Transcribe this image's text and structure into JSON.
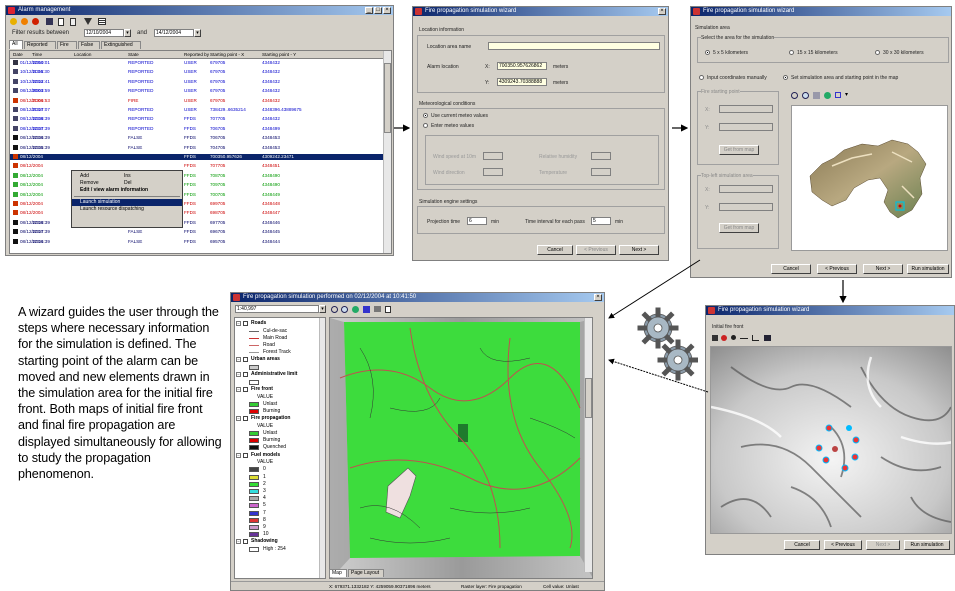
{
  "alarm_window": {
    "title": "Alarm management",
    "filter_label": "Filter results between",
    "date_from": "12/10/2004",
    "and_label": "and",
    "date_to": "14/12/2004",
    "tabs": [
      "All",
      "Reported",
      "Fire",
      "False",
      "Extinguished"
    ],
    "columns": [
      "Date",
      "Time",
      "Location",
      "State",
      "Reported by",
      "Starting point - X",
      "Starting point - Y"
    ],
    "rows": [
      {
        "date": "01/12/2004",
        "time": "12:50:01",
        "location": "",
        "state": "REPORTED",
        "by": "USER",
        "x": "679705",
        "y": "4348432",
        "color": "#0000cc"
      },
      {
        "date": "10/12/2004",
        "time": "11:36:30",
        "location": "",
        "state": "REPORTED",
        "by": "USER",
        "x": "679705",
        "y": "4348432",
        "color": "#0000cc"
      },
      {
        "date": "10/12/2004",
        "time": "12:22:41",
        "location": "",
        "state": "REPORTED",
        "by": "USER",
        "x": "679705",
        "y": "4348432",
        "color": "#0000cc"
      },
      {
        "date": "08/12/2004",
        "time": "20:03:59",
        "location": "",
        "state": "REPORTED",
        "by": "USER",
        "x": "679705",
        "y": "4348432",
        "color": "#0000cc"
      },
      {
        "date": "08/12/2004",
        "time": "21:06:53",
        "location": "",
        "state": "FIRE",
        "by": "USER",
        "x": "679705",
        "y": "4348432",
        "color": "#cc0000"
      },
      {
        "date": "08/12/2004",
        "time": "21:27:07",
        "location": "",
        "state": "REPORTED",
        "by": "USER",
        "x": "738429..6635214",
        "y": "4348396.43889675",
        "color": "#0000cc"
      },
      {
        "date": "08/12/2004",
        "time": "12:38:39",
        "location": "",
        "state": "REPORTED",
        "by": "FFDS",
        "x": "707705",
        "y": "4348432",
        "color": "#0000cc"
      },
      {
        "date": "08/12/2004",
        "time": "12:37:39",
        "location": "",
        "state": "REPORTED",
        "by": "FFDS",
        "x": "706705",
        "y": "4348499",
        "color": "#0000cc"
      },
      {
        "date": "08/12/2004",
        "time": "12:36:39",
        "location": "",
        "state": "FALSE",
        "by": "FFDS",
        "x": "706705",
        "y": "4348453",
        "color": "#000066"
      },
      {
        "date": "08/12/2004",
        "time": "12:35:39",
        "location": "",
        "state": "FALSE",
        "by": "FFDS",
        "x": "704705",
        "y": "4348453",
        "color": "#000066"
      },
      {
        "date": "08/12/2004",
        "time": "",
        "location": "",
        "state": "",
        "by": "FFDS",
        "x": "700350.957626",
        "y": "4309242.23471",
        "color": "#ffffff"
      },
      {
        "date": "08/12/2004",
        "time": "",
        "location": "",
        "state": "",
        "by": "FFDS",
        "x": "707705",
        "y": "4348451",
        "color": "#cc0000"
      },
      {
        "date": "08/12/2004",
        "time": "",
        "location": "",
        "state": "",
        "by": "FFDS",
        "x": "708705",
        "y": "4348490",
        "color": "#009900"
      },
      {
        "date": "08/12/2004",
        "time": "",
        "location": "",
        "state": "",
        "by": "FFDS",
        "x": "709705",
        "y": "4348490",
        "color": "#009900"
      },
      {
        "date": "08/12/2004",
        "time": "",
        "location": "",
        "state": "",
        "by": "FFDS",
        "x": "700705",
        "y": "4348449",
        "color": "#009900"
      },
      {
        "date": "08/12/2004",
        "time": "",
        "location": "",
        "state": "",
        "by": "FFDS",
        "x": "699705",
        "y": "4348448",
        "color": "#cc0000"
      },
      {
        "date": "08/12/2004",
        "time": "",
        "location": "",
        "state": "",
        "by": "FFDS",
        "x": "698705",
        "y": "4348447",
        "color": "#cc0000"
      },
      {
        "date": "08/12/2004",
        "time": "12:28:39",
        "location": "Perdunta",
        "state": "FALSE",
        "by": "FFDS",
        "x": "697705",
        "y": "4348446",
        "color": "#000066"
      },
      {
        "date": "08/12/2004",
        "time": "12:27:39",
        "location": "",
        "state": "FALSE",
        "by": "FFDS",
        "x": "696705",
        "y": "4348445",
        "color": "#000066"
      },
      {
        "date": "08/12/2004",
        "time": "12:26:39",
        "location": "",
        "state": "FALSE",
        "by": "FFDS",
        "x": "695705",
        "y": "4348444",
        "color": "#000066"
      }
    ],
    "context_menu": [
      {
        "label": "Add",
        "shortcut": "Ins"
      },
      {
        "label": "Remove",
        "shortcut": "Del"
      },
      {
        "label": "Edit / view alarm information",
        "shortcut": ""
      },
      {
        "label": "Launch simulation",
        "shortcut": ""
      },
      {
        "label": "Launch resource dispatching",
        "shortcut": ""
      }
    ]
  },
  "wizard1": {
    "title": "Fire propagation simulation wizard",
    "section_location": "Location information",
    "location_area_name": "Location area name",
    "alarm_location": "Alarm location",
    "x_label": "X:",
    "y_label": "Y:",
    "x_value": "700350.957626862",
    "y_value": "4309243.70388888",
    "meters": "meters",
    "section_meteo": "Meteorological conditions",
    "use_current": "Use current meteo values",
    "enter_values": "Enter meteo values",
    "wind_speed": "Wind speed at 10m",
    "wind_direction": "Wind direction",
    "relative_humidity": "Relative humidity",
    "temperature": "Temperature",
    "section_engine": "Simulation engine settings",
    "projection_time": "Projection time",
    "projection_value": "6",
    "interval": "Time interval for each pass",
    "interval_value": "5",
    "min": "min",
    "cancel": "Cancel",
    "previous": "< Previous",
    "next": "Next >"
  },
  "wizard2": {
    "title": "Fire propagation simulation wizard",
    "sim_area": "Simulation area",
    "select_area": "Select the area for the simulation",
    "opt1": "5 x 5 kilometers",
    "opt2": "15 x 15 kilometers",
    "opt3": "30 x 30 kilometers",
    "input_manually": "Input coordinates manually",
    "set_on_map": "Set simulation area and starting point in the map",
    "fire_starting_point": "Fire starting point",
    "top_left": "Top-left simulation area",
    "get_button": "Get from map",
    "x_label": "X:",
    "y_label": "Y:",
    "cancel": "Cancel",
    "previous": "< Previous",
    "next": "Next >",
    "run": "Run simulation"
  },
  "wizard3": {
    "title": "Fire propagation simulation wizard",
    "initial_fire_front": "Initial fire front",
    "cancel": "Cancel",
    "previous": "< Previous",
    "next": "Next >",
    "run": "Run simulation"
  },
  "result_window": {
    "title": "Fire propagation simulation performed on 02/12/2004 at 10:41:50",
    "scale": "1:40,997",
    "legend": [
      {
        "label": "Roads",
        "type": "group"
      },
      {
        "label": "Cul-de-sac",
        "type": "line",
        "color": "#666666"
      },
      {
        "label": "Main Road",
        "type": "line",
        "color": "#cc3333"
      },
      {
        "label": "Road",
        "type": "line",
        "color": "#cc6666"
      },
      {
        "label": "Forest Track",
        "type": "line",
        "color": "#999999"
      },
      {
        "label": "Urban areas",
        "type": "group"
      },
      {
        "label": "",
        "type": "swatch",
        "color": "#cccccc"
      },
      {
        "label": "Administrative limit",
        "type": "group"
      },
      {
        "label": "",
        "type": "swatch",
        "color": "#ffffff"
      },
      {
        "label": "Fire front",
        "type": "group"
      },
      {
        "label": "VALUE",
        "type": "text"
      },
      {
        "label": "Unlast",
        "type": "swatch",
        "color": "#33cc33"
      },
      {
        "label": "Burning",
        "type": "swatch",
        "color": "#dd0000"
      },
      {
        "label": "Fire propagation",
        "type": "group"
      },
      {
        "label": "VALUE",
        "type": "text"
      },
      {
        "label": "Unlast",
        "type": "swatch",
        "color": "#33cc33"
      },
      {
        "label": "Burning",
        "type": "swatch",
        "color": "#dd0000"
      },
      {
        "label": "Quenched",
        "type": "swatch",
        "color": "#111111"
      },
      {
        "label": "Fuel models",
        "type": "group"
      },
      {
        "label": "VALUE",
        "type": "text"
      },
      {
        "label": "0",
        "type": "swatch",
        "color": "#444444"
      },
      {
        "label": "1",
        "type": "swatch",
        "color": "#dddd33"
      },
      {
        "label": "2",
        "type": "swatch",
        "color": "#33dd33"
      },
      {
        "label": "3",
        "type": "swatch",
        "color": "#33dddd"
      },
      {
        "label": "4",
        "type": "swatch",
        "color": "#aaaaaa"
      },
      {
        "label": "5",
        "type": "swatch",
        "color": "#cc66cc"
      },
      {
        "label": "7",
        "type": "swatch",
        "color": "#3333cc"
      },
      {
        "label": "8",
        "type": "swatch",
        "color": "#dd3333"
      },
      {
        "label": "9",
        "type": "swatch",
        "color": "#cc99cc"
      },
      {
        "label": "10",
        "type": "swatch",
        "color": "#663399"
      },
      {
        "label": "Shadowing",
        "type": "group"
      },
      {
        "label": "High : 254",
        "type": "swatch",
        "color": "#ffffff"
      }
    ],
    "tabs": [
      "Map",
      "Page Layout"
    ],
    "status_coords": "X: 679371.1332182  Y: 4259059.90371896 meters",
    "status_layer": "Raster layer: Fire propagation",
    "status_cell": "Cell value: Unlast"
  },
  "description": "A wizard guides the user through the steps where necessary information for the simulation is defined. The starting point of the alarm can be moved and new elements drawn in the simulation area for the initial fire front. Both maps of initial fire front and final fire propagation are displayed simultaneously for allowing to study the propagation phenomenon."
}
